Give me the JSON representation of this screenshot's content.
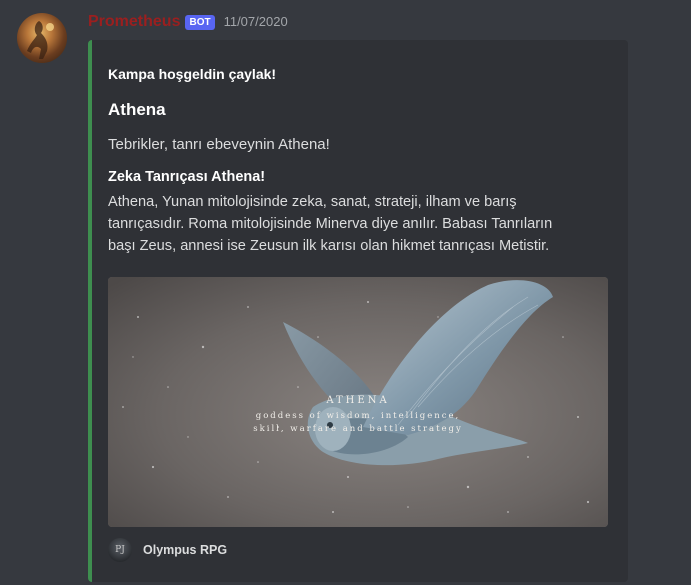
{
  "message": {
    "username": "Prometheus",
    "bot_tag": "BOT",
    "timestamp": "11/07/2020"
  },
  "embed": {
    "accent_color": "#3e8e4f",
    "author": "Kampa hoşgeldin çaylak!",
    "title": "Athena",
    "description": "Tebrikler, tanrı ebeveynin Athena!",
    "field": {
      "name": "Zeka Tanrıçası Athena!",
      "value_lines": [
        "Athena, Yunan mitolojisinde zeka, sanat, strateji, ilham ve barış",
        "tanrıçasıdır. Roma mitolojisinde Minerva diye anılır. Babası Tanrıların",
        "başı Zeus, annesi ise Zeusun ilk karısı olan hikmet tanrıçası Metistir."
      ]
    },
    "image": {
      "caption_title": "ATHENA",
      "caption_line1": "goddess of wisdom, intelligence,",
      "caption_line2": "skill, warfare and battle strategy"
    },
    "footer": {
      "icon_label": "PJ",
      "text": "Olympus RPG"
    }
  },
  "colors": {
    "username": "#9b1f1f",
    "bot_tag_bg": "#5865f2",
    "background": "#36393f",
    "embed_bg": "#2f3136"
  }
}
